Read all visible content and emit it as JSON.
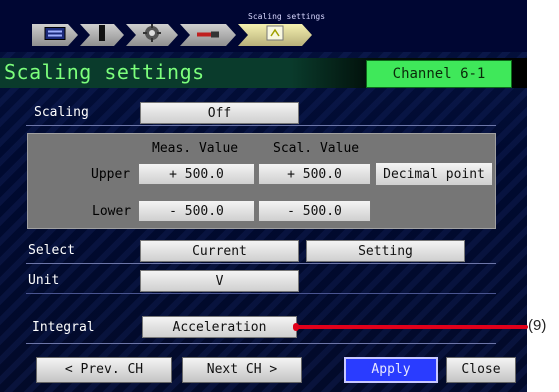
{
  "breadcrumb": {
    "label": "Scaling settings"
  },
  "header": {
    "title": "Scaling settings",
    "channel": "Channel 6-1"
  },
  "scaling": {
    "label": "Scaling",
    "value": "Off"
  },
  "table": {
    "col_meas": "Meas. Value",
    "col_scal": "Scal. Value",
    "upper": {
      "label": "Upper",
      "meas": "+ 500.0",
      "scal": "+  500.0"
    },
    "lower": {
      "label": "Lower",
      "meas": "- 500.0",
      "scal": "-  500.0"
    },
    "decimal_button": "Decimal point"
  },
  "select": {
    "label": "Select",
    "current": "Current",
    "setting": "Setting"
  },
  "unit": {
    "label": "Unit",
    "value": "V"
  },
  "integral": {
    "label": "Integral",
    "value": "Acceleration"
  },
  "buttons": {
    "prev": "< Prev. CH",
    "next": "Next CH >",
    "apply": "Apply",
    "close": "Close"
  },
  "annotation": {
    "callout": "(9)"
  },
  "colors": {
    "title_green": "#7cff7c",
    "channel_green": "#3fe85a",
    "apply_blue": "#2a3cff",
    "callout_red": "#e0001a"
  },
  "icons": [
    "keyboard-icon",
    "input-icon",
    "gear-icon",
    "probe-icon",
    "scaling-icon"
  ]
}
